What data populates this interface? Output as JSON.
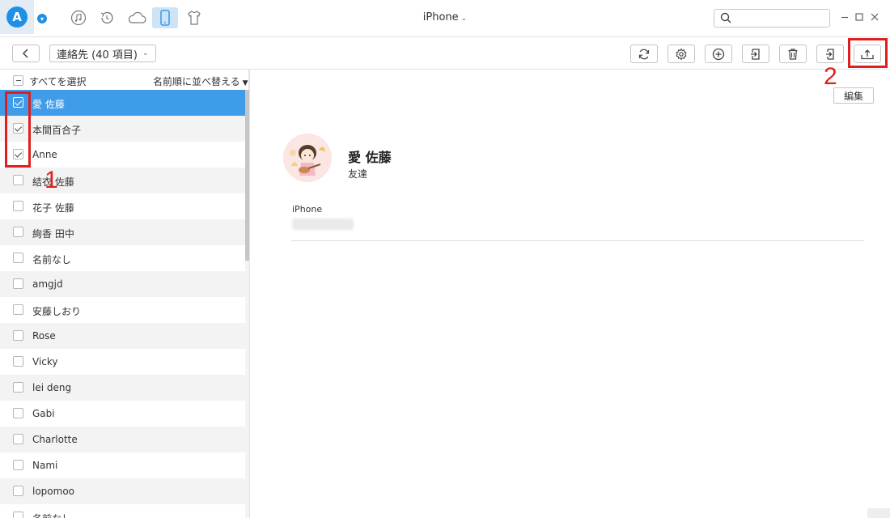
{
  "titlebar": {
    "device": "iPhone",
    "search": {
      "placeholder": "",
      "value": ""
    },
    "icons": [
      "music-icon",
      "history-icon",
      "cloud-icon",
      "phone-icon",
      "tshirt-icon"
    ]
  },
  "toolbar": {
    "category": "連絡先 (40 項目)",
    "buttons": [
      "refresh-icon",
      "settings-icon",
      "add-icon",
      "import-icon",
      "delete-icon",
      "send-to-device-icon",
      "export-to-computer-icon"
    ]
  },
  "list": {
    "select_all": "すべてを選択",
    "sort": "名前順に並べ替える",
    "contacts": [
      {
        "name": "愛 佐藤",
        "checked": true,
        "selected": true
      },
      {
        "name": "本間百合子",
        "checked": true
      },
      {
        "name": "Anne",
        "checked": true
      },
      {
        "name": "結衣 佐藤",
        "checked": false
      },
      {
        "name": "花子 佐藤",
        "checked": false
      },
      {
        "name": "絢香 田中",
        "checked": false
      },
      {
        "name": "名前なし",
        "checked": false
      },
      {
        "name": "amgjd",
        "checked": false
      },
      {
        "name": "安藤しおり",
        "checked": false
      },
      {
        "name": "Rose",
        "checked": false
      },
      {
        "name": "Vicky",
        "checked": false
      },
      {
        "name": "lei deng",
        "checked": false
      },
      {
        "name": "Gabi",
        "checked": false
      },
      {
        "name": "Charlotte",
        "checked": false
      },
      {
        "name": "Nami",
        "checked": false
      },
      {
        "name": "lopomoo",
        "checked": false
      },
      {
        "name": "名前なし",
        "checked": false
      }
    ]
  },
  "detail": {
    "edit": "編集",
    "name": "愛 佐藤",
    "group": "友達",
    "phone_label": "iPhone"
  },
  "annotations": {
    "step1": "1",
    "step2": "2"
  },
  "colors": {
    "accent": "#3f9ce8",
    "highlight": "#e01e1e"
  }
}
